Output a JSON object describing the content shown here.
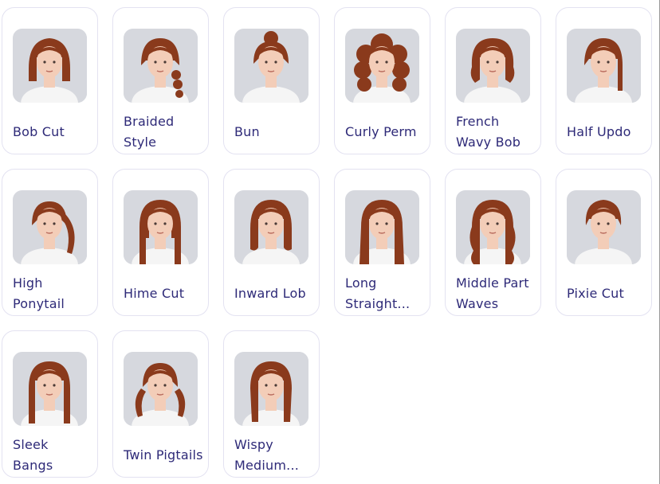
{
  "colors": {
    "label_text": "#2e2a78",
    "card_border": "#e3e2f1",
    "hair": "#8a3a1c",
    "skin": "#f3cdb8",
    "shirt": "#f5f5f5",
    "backdrop": "#d6d8de"
  },
  "styles": [
    {
      "label": "Bob Cut",
      "icon": "portrait-bob-cut"
    },
    {
      "label": "Braided Style",
      "icon": "portrait-braided-style"
    },
    {
      "label": "Bun",
      "icon": "portrait-bun"
    },
    {
      "label": "Curly Perm",
      "icon": "portrait-curly-perm"
    },
    {
      "label": "French Wavy Bob",
      "icon": "portrait-french-wavy-bob"
    },
    {
      "label": "Half Updo",
      "icon": "portrait-half-updo"
    },
    {
      "label": "High Ponytail",
      "icon": "portrait-high-ponytail"
    },
    {
      "label": "Hime Cut",
      "icon": "portrait-hime-cut"
    },
    {
      "label": "Inward Lob",
      "icon": "portrait-inward-lob"
    },
    {
      "label": "Long Straight...",
      "icon": "portrait-long-straight"
    },
    {
      "label": "Middle Part Waves",
      "icon": "portrait-middle-part-waves"
    },
    {
      "label": "Pixie Cut",
      "icon": "portrait-pixie-cut"
    },
    {
      "label": "Sleek Bangs",
      "icon": "portrait-sleek-bangs"
    },
    {
      "label": "Twin Pigtails",
      "icon": "portrait-twin-pigtails"
    },
    {
      "label": "Wispy Medium...",
      "icon": "portrait-wispy-medium"
    }
  ]
}
